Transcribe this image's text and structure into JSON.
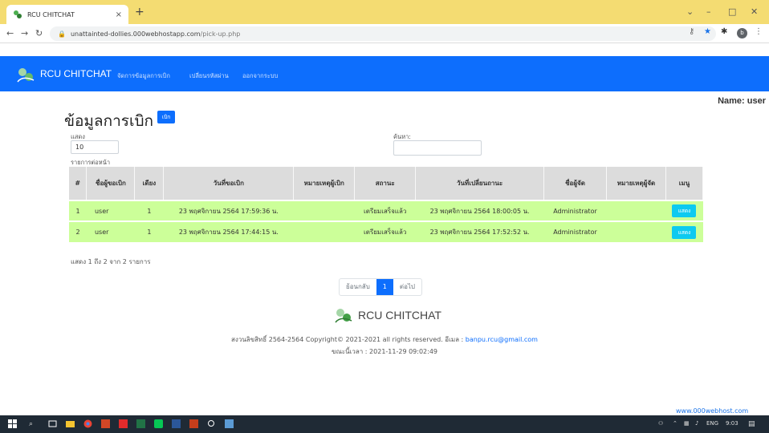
{
  "browser": {
    "tab_title": "RCU CHITCHAT",
    "tab_close": "×",
    "new_tab": "+",
    "url_host": "unattainted-dollies.000webhostapp.com",
    "url_path": "/pick-up.php",
    "profile_letter": "b"
  },
  "navbar": {
    "brand": "RCU CHITCHAT",
    "links": [
      "จัดการข้อมูลการเบิก",
      "เปลี่ยนรหัสผ่าน",
      "ออกจากระบบ"
    ]
  },
  "user": {
    "name_label": "Name: user"
  },
  "page": {
    "title": "ข้อมูลการเบิก",
    "add_button": "เบิก",
    "show_label": "แสดง",
    "show_value": "10",
    "per_page_label": "รายการต่อหน้า",
    "search_label": "ค้นหา:",
    "search_value": ""
  },
  "table": {
    "headers": [
      "#",
      "ชื่อผู้ขอเบิก",
      "เดียง",
      "วันที่ขอเบิก",
      "หมายเหตุผู้เบิก",
      "สถานะ",
      "วันที่เปลี่ยนถานะ",
      "ชื่อผู้จัด",
      "หมายเหตุผู้จัด",
      "เมนู"
    ],
    "rows": [
      [
        "1",
        "user",
        "1",
        "23 พฤศจิกายน 2564 17:59:36 น.",
        "",
        "เตรียมเสร็จแล้ว",
        "23 พฤศจิกายน 2564 18:00:05 น.",
        "Administrator",
        "",
        "แสดง"
      ],
      [
        "2",
        "user",
        "1",
        "23 พฤศจิกายน 2564 17:44:15 น.",
        "",
        "เตรียมเสร็จแล้ว",
        "23 พฤศจิกายน 2564 17:52:52 น.",
        "Administrator",
        "",
        "แสดง"
      ]
    ]
  },
  "pagination": {
    "info": "แสดง 1 ถึง 2 จาก 2 รายการ",
    "prev": "ย้อนกลับ",
    "current": "1",
    "next": "ต่อไป"
  },
  "footer": {
    "brand": "RCU CHITCHAT",
    "line1": "สงวนลิขสิทธิ์ 2564-2564 Copyright© 2021-2021 all rights reserved. อีเมล :",
    "email": "banpu.rcu@gmail.com",
    "line2": "ขณะนี้เวลา : 2021-11-29 09:02:49"
  },
  "hosting": {
    "label": "www.000webhost.com"
  },
  "taskbar": {
    "lang": "ENG",
    "time": "9:03"
  },
  "colors": {
    "primary": "#0d6efd",
    "row_bg": "#ccff99",
    "info_btn": "#0dcaf0"
  }
}
